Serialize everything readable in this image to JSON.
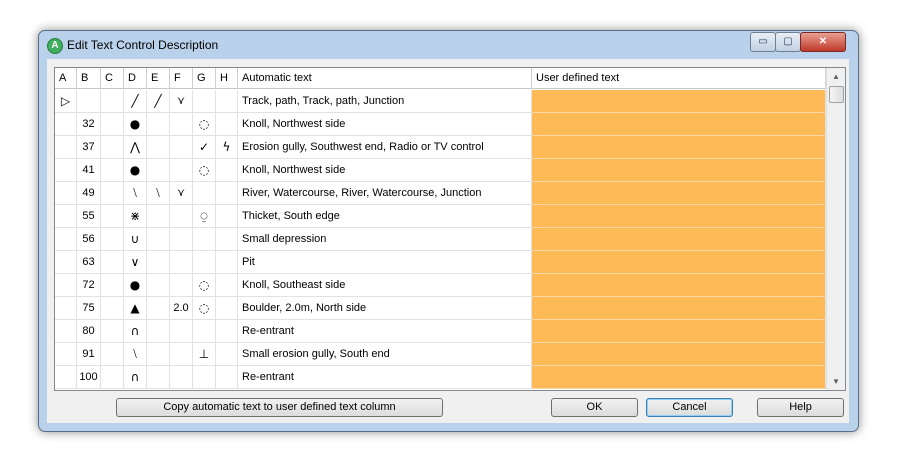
{
  "window": {
    "title": "Edit Text Control Description",
    "icon_letter": "A",
    "min": "▭",
    "max": "▢",
    "close": "✕"
  },
  "columns": [
    "A",
    "B",
    "C",
    "D",
    "E",
    "F",
    "G",
    "H",
    "Automatic text",
    "User defined text"
  ],
  "rows": [
    {
      "b": "",
      "c": "",
      "a": "▷",
      "d": "╱",
      "e": "╱",
      "f": "⋎",
      "g": "",
      "h": "",
      "auto": "Track, path, Track, path, Junction"
    },
    {
      "b": "32",
      "a": "",
      "c": "",
      "d": "●",
      "e": "",
      "f": "",
      "g": "◌",
      "h": "",
      "auto": "Knoll, Northwest side"
    },
    {
      "b": "37",
      "a": "",
      "c": "",
      "d": "⋀",
      "e": "",
      "f": "",
      "g": "✓",
      "h": "ϟ",
      "auto": "Erosion gully, Southwest end, Radio or TV control"
    },
    {
      "b": "41",
      "a": "",
      "c": "",
      "d": "●",
      "e": "",
      "f": "",
      "g": "◌",
      "h": "",
      "auto": "Knoll, Northwest side"
    },
    {
      "b": "49",
      "a": "",
      "c": "",
      "d": "⧵",
      "e": "⧵",
      "f": "⋎",
      "g": "",
      "h": "",
      "auto": "River, Watercourse, River, Watercourse, Junction"
    },
    {
      "b": "55",
      "a": "",
      "c": "",
      "d": "⋇",
      "e": "",
      "f": "",
      "g": "⍜",
      "h": "",
      "auto": "Thicket, South edge"
    },
    {
      "b": "56",
      "a": "",
      "c": "",
      "d": "∪",
      "e": "",
      "f": "",
      "g": "",
      "h": "",
      "auto": "Small depression"
    },
    {
      "b": "63",
      "a": "",
      "c": "",
      "d": "∨",
      "e": "",
      "f": "",
      "g": "",
      "h": "",
      "auto": "Pit"
    },
    {
      "b": "72",
      "a": "",
      "c": "",
      "d": "●",
      "e": "",
      "f": "",
      "g": "◌",
      "h": "",
      "auto": "Knoll, Southeast side"
    },
    {
      "b": "75",
      "a": "",
      "c": "",
      "d": "▲",
      "e": "",
      "f": "2.0",
      "g": "◌",
      "h": "",
      "auto": "Boulder, 2.0m, North side"
    },
    {
      "b": "80",
      "a": "",
      "c": "",
      "d": "∩",
      "e": "",
      "f": "",
      "g": "",
      "h": "",
      "auto": "Re-entrant"
    },
    {
      "b": "91",
      "a": "",
      "c": "",
      "d": "⧵",
      "e": "",
      "f": "",
      "g": "⊥",
      "h": "",
      "auto": "Small erosion gully, South end"
    },
    {
      "b": "100",
      "a": "",
      "c": "",
      "d": "∩",
      "e": "",
      "f": "",
      "g": "",
      "h": "",
      "auto": "Re-entrant"
    }
  ],
  "buttons": {
    "copy": "Copy automatic text to user defined text column",
    "ok": "OK",
    "cancel": "Cancel",
    "help": "Help"
  },
  "colors": {
    "user_cell": "#fdba57"
  }
}
